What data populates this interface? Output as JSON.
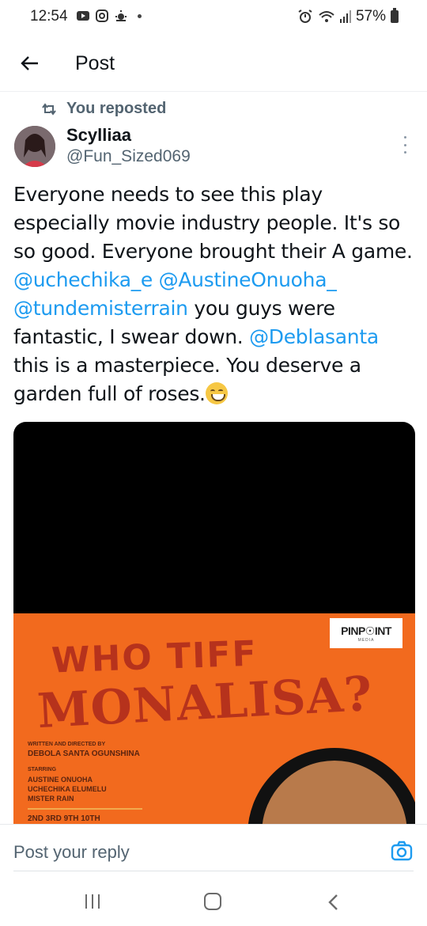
{
  "status_bar": {
    "time": "12:54",
    "battery": "57%",
    "left_icons": [
      "youtube-icon",
      "instagram-icon",
      "weather-icon"
    ],
    "right_icons": [
      "alarm-icon",
      "wifi-icon",
      "signal-icon",
      "battery-icon"
    ]
  },
  "app_bar": {
    "title": "Post"
  },
  "post": {
    "repost_label": "You reposted",
    "author_name": "Scylliaa",
    "author_handle": "@Fun_Sized069",
    "text": {
      "part1": "Everyone needs to see this play especially movie industry people. It's so so good. Everyone brought their A game.  ",
      "mention1": "@uchechika_e",
      "mention2": "@AustineOnuoha_",
      "mention3": "@tundemisterrain",
      "part2": " you guys were fantastic, I swear down. ",
      "mention4": "@Deblasanta",
      "part3": " this is a masterpiece. You deserve a garden full of roses."
    },
    "media": {
      "badge_text": "PINP☉INT",
      "badge_sub": "MEDIA",
      "title_line1": "WHO TIFF",
      "title_line2": "MONALISA?",
      "written_label": "WRITTEN AND DIRECTED BY",
      "writer": "DEBOLA SANTA OGUNSHINA",
      "starring_label": "STARRING",
      "cast1": "AUSTINE ONUOHA",
      "cast2": "UCHECHIKA ELUMELU",
      "cast3": "MISTER RAIN",
      "dates": "2ND 3RD 9TH 10TH"
    }
  },
  "reply": {
    "placeholder": "Post your reply"
  },
  "colors": {
    "accent": "#1d9bf0",
    "secondary_text": "#536471",
    "poster_orange": "#f26a1e",
    "poster_title": "#b6321c"
  }
}
